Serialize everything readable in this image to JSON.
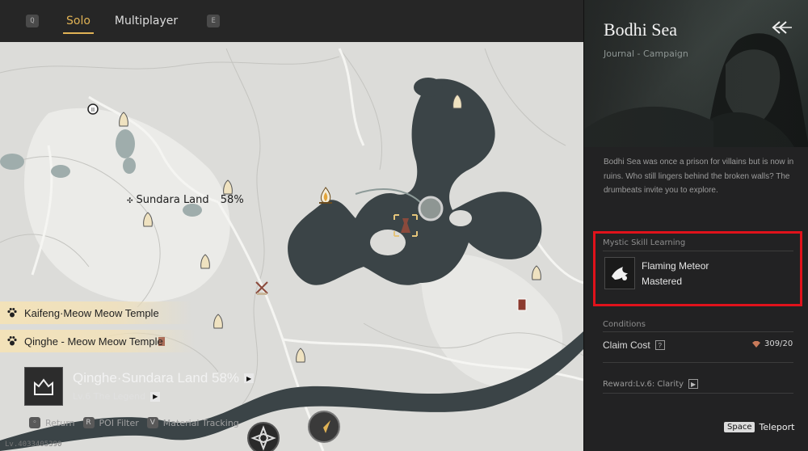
{
  "modebar": {
    "left_key": "Q",
    "tabs": [
      {
        "label": "Solo",
        "active": true
      },
      {
        "label": "Multiplayer",
        "active": false
      }
    ],
    "right_key": "E"
  },
  "map": {
    "region_label": "Sundara Land",
    "region_percent": "58%"
  },
  "banners": [
    {
      "label": "Kaifeng·Meow Meow Temple"
    },
    {
      "label": "Qinghe - Meow Meow Temple"
    }
  ],
  "region_info": {
    "title": "Qinghe·Sundara Land 58%",
    "subtitle": "Lv.6 The Legend"
  },
  "hints": [
    {
      "key": "",
      "label": "Return"
    },
    {
      "key": "R",
      "label": "POI Filter"
    },
    {
      "key": "V",
      "label": "Material Tracking"
    }
  ],
  "uid": "Lv.4033405390",
  "panel": {
    "title": "Bodhi Sea",
    "subtitle": "Journal - Campaign",
    "description": "Bodhi Sea was once a prison for villains but is now in ruins. Who still lingers behind the broken walls? The drumbeats invite you to explore.",
    "skill_section": "Mystic Skill Learning",
    "skill_name": "Flaming Meteor",
    "skill_status": "Mastered",
    "conditions_label": "Conditions",
    "claim_label": "Claim Cost",
    "claim_value": "309/20",
    "reward_label": "Reward:Lv.6: Clarity",
    "teleport_key": "Space",
    "teleport_label": "Teleport"
  },
  "colors": {
    "accent": "#e0b255",
    "highlight": "#e0121b",
    "panel_bg": "#222223",
    "map_bg": "#dcdcd9",
    "water": "#3b4447"
  }
}
